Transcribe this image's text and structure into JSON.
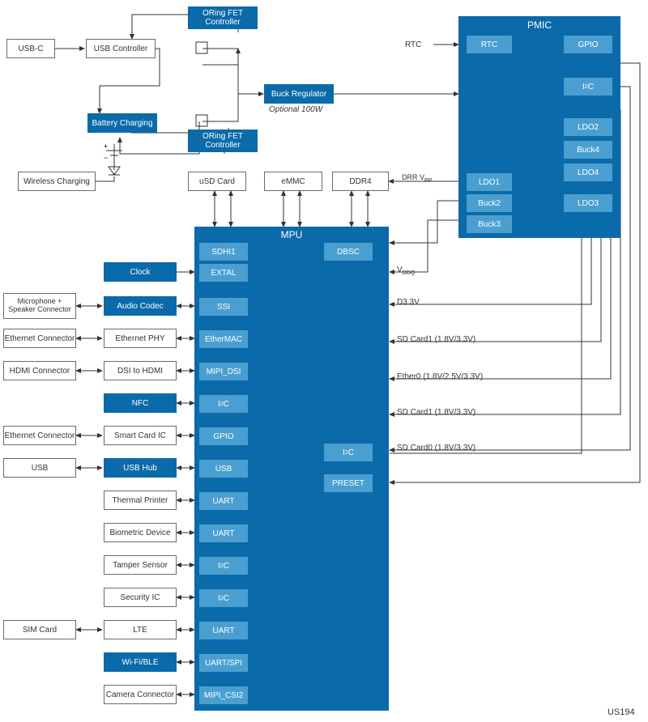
{
  "diagram_id": "US194",
  "top": {
    "usbc": "USB-C",
    "usbctrl": "USB Controller",
    "oring1": "ORing FET Controller",
    "oring2": "ORing FET Controller",
    "batt": "Battery Charging",
    "wireless": "Wireless Charging",
    "buck": "Buck Regulator",
    "buck_note": "Optional 100W",
    "rtc": "RTC"
  },
  "pmic": {
    "title": "PMIC",
    "rtc": "RTC",
    "gpio": "GPIO",
    "i2c": "I²C",
    "ldo2": "LDO2",
    "buck4": "Buck4",
    "ldo4": "LDO4",
    "ldo1": "LDO1",
    "buck2": "Buck2",
    "ldo3": "LDO3",
    "buck3": "Buck3"
  },
  "mem": {
    "usd": "uSD Card",
    "emmc": "eMMC",
    "ddr4": "DDR4",
    "ddr_vpp": "DRR Vₚₚ"
  },
  "mpu": {
    "title": "MPU",
    "sdhi1": "SDHI1",
    "dbsc": "DBSC",
    "extal": "EXTAL",
    "ssi": "SSI",
    "ethermac": "EtherMAC",
    "mipi_dsi": "MIPI_DSI",
    "i2c": "I²C",
    "gpio": "GPIO",
    "usb": "USB",
    "uart": "UART",
    "uart_spi": "UART/SPI",
    "mipi_csi2": "MIPI_CSI2",
    "preset": "PRESET"
  },
  "left": {
    "clock": "Clock",
    "mic": "Microphone + Speaker Connector",
    "audio": "Audio Codec",
    "ethcon": "Ethernet Connector",
    "ethphy": "Ethernet PHY",
    "hdmi": "HDMI Connector",
    "dsi": "DSI to HDMI",
    "nfc": "NFC",
    "ethcon2": "Ethernet Connector",
    "smartcard": "Smart Card IC",
    "usb": "USB",
    "usbhub": "USB Hub",
    "thermal": "Thermal Printer",
    "bio": "Biometric Device",
    "tamper": "Tamper Sensor",
    "sec": "Security IC",
    "sim": "SIM Card",
    "lte": "LTE",
    "wifi": "Wi-Fi/BLE",
    "camera": "Camera Connector"
  },
  "signals": {
    "vddq": "V_DDQ",
    "d33": "D3.3V",
    "sd1a": "SD Card1 (1.8V/3.3V)",
    "eth0": "Ether0 (1.8V/2.5V/3.3V)",
    "sd1b": "SD Card1 (1.8V/3.3V)",
    "sd0": "SD Card0 (1.8V/3.3V)"
  }
}
